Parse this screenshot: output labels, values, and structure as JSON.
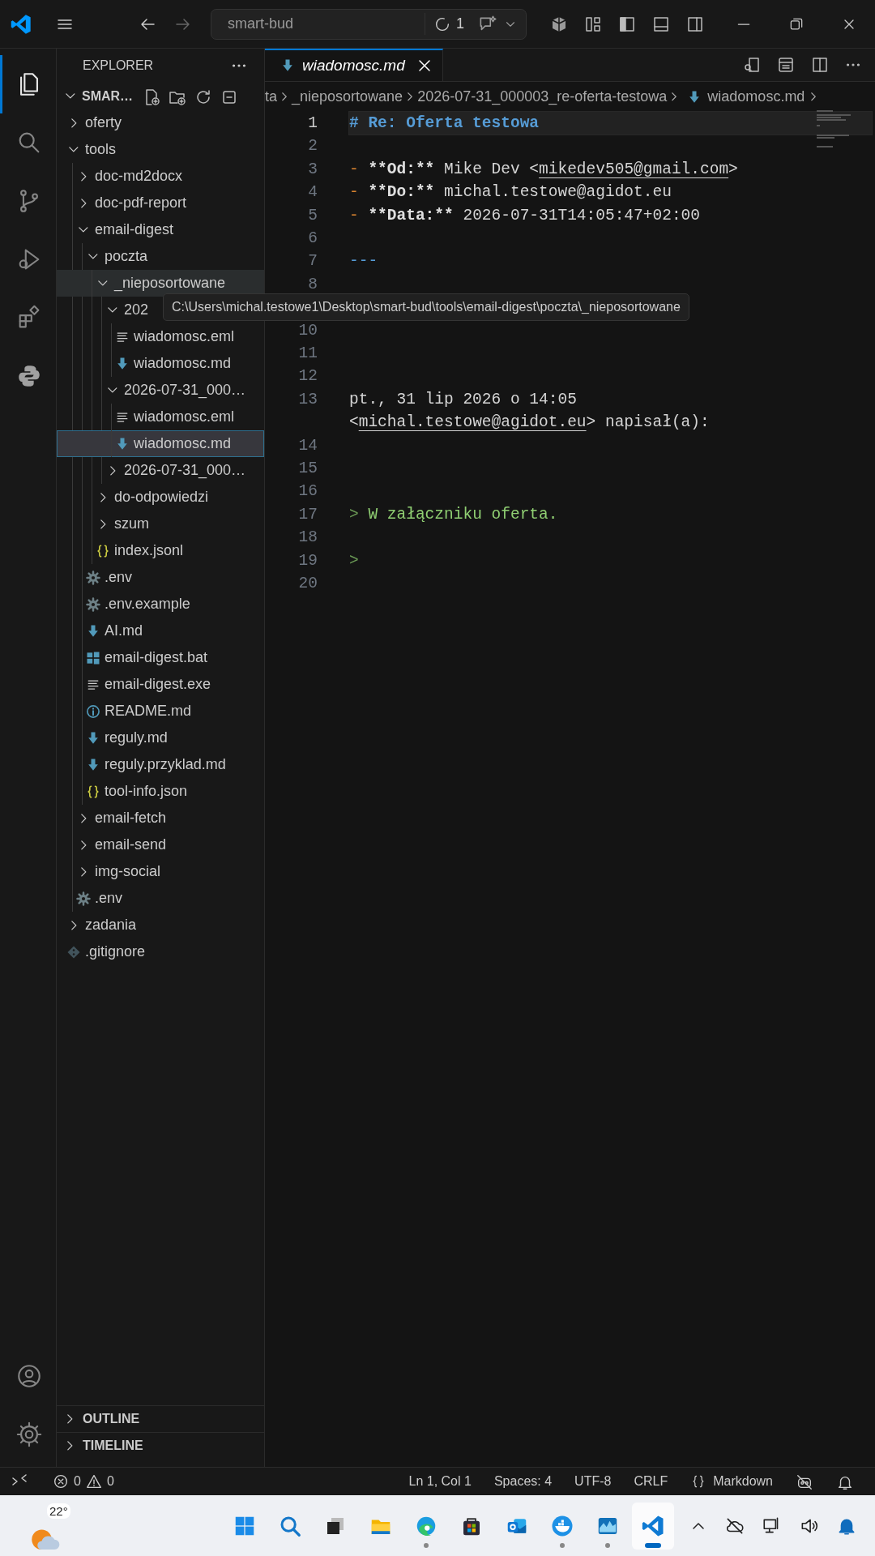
{
  "title_bar": {
    "search": "smart-bud",
    "agent_count": "1"
  },
  "activity_bar": [
    {
      "kind": "explorer",
      "selected": true
    },
    {
      "kind": "search",
      "selected": false
    },
    {
      "kind": "source-control",
      "selected": false
    },
    {
      "kind": "run-debug",
      "selected": false
    },
    {
      "kind": "extensions",
      "selected": false
    },
    {
      "kind": "python",
      "selected": false
    }
  ],
  "explorer": {
    "title": "EXPLORER",
    "root": "SMAR…",
    "expanded": true,
    "tree": [
      {
        "kind": "folder",
        "label": "oferty",
        "expanded": false,
        "selected": false,
        "hovered": false
      },
      {
        "kind": "folder",
        "label": "tools",
        "expanded": true,
        "selected": false,
        "hovered": false,
        "children": [
          {
            "kind": "folder",
            "label": "doc-md2docx",
            "expanded": false,
            "selected": false,
            "hovered": false
          },
          {
            "kind": "folder",
            "label": "doc-pdf-report",
            "expanded": false,
            "selected": false,
            "hovered": false
          },
          {
            "kind": "folder",
            "label": "email-digest",
            "expanded": true,
            "selected": false,
            "hovered": false,
            "children": [
              {
                "kind": "folder",
                "label": "poczta",
                "expanded": true,
                "selected": false,
                "hovered": false,
                "children": [
                  {
                    "kind": "folder",
                    "label": "_nieposortowane",
                    "expanded": true,
                    "selected": false,
                    "hovered": true,
                    "children": [
                      {
                        "kind": "folder",
                        "label": "202",
                        "expanded": true,
                        "selected": false,
                        "hovered": false,
                        "children": [
                          {
                            "kind": "text-file",
                            "label": "wiadomosc.eml",
                            "selected": false,
                            "hovered": false
                          },
                          {
                            "kind": "md-file",
                            "label": "wiadomosc.md",
                            "selected": false,
                            "hovered": false
                          }
                        ]
                      },
                      {
                        "kind": "folder",
                        "label": "2026-07-31_000…",
                        "expanded": true,
                        "selected": false,
                        "hovered": false,
                        "children": [
                          {
                            "kind": "text-file",
                            "label": "wiadomosc.eml",
                            "selected": false,
                            "hovered": false
                          },
                          {
                            "kind": "md-file",
                            "label": "wiadomosc.md",
                            "selected": true,
                            "hovered": false
                          }
                        ]
                      },
                      {
                        "kind": "folder",
                        "label": "2026-07-31_000…",
                        "expanded": false,
                        "selected": false,
                        "hovered": false
                      }
                    ]
                  },
                  {
                    "kind": "folder",
                    "label": "do-odpowiedzi",
                    "expanded": false,
                    "selected": false,
                    "hovered": false
                  },
                  {
                    "kind": "folder",
                    "label": "szum",
                    "expanded": false,
                    "selected": false,
                    "hovered": false
                  },
                  {
                    "kind": "json-file",
                    "label": "index.jsonl",
                    "selected": false,
                    "hovered": false
                  }
                ]
              },
              {
                "kind": "settings-file",
                "label": ".env",
                "selected": false,
                "hovered": false
              },
              {
                "kind": "settings-file",
                "label": ".env.example",
                "selected": false,
                "hovered": false
              },
              {
                "kind": "md-file",
                "label": "AI.md",
                "selected": false,
                "hovered": false
              },
              {
                "kind": "windows-file",
                "label": "email-digest.bat",
                "selected": false,
                "hovered": false
              },
              {
                "kind": "text-file",
                "label": "email-digest.exe",
                "selected": false,
                "hovered": false
              },
              {
                "kind": "info-file",
                "label": "README.md",
                "selected": false,
                "hovered": false
              },
              {
                "kind": "md-file",
                "label": "reguly.md",
                "selected": false,
                "hovered": false
              },
              {
                "kind": "md-file",
                "label": "reguly.przyklad.md",
                "selected": false,
                "hovered": false
              },
              {
                "kind": "json-file",
                "label": "tool-info.json",
                "selected": false,
                "hovered": false
              }
            ]
          },
          {
            "kind": "folder",
            "label": "email-fetch",
            "expanded": false,
            "selected": false,
            "hovered": false
          },
          {
            "kind": "folder",
            "label": "email-send",
            "expanded": false,
            "selected": false,
            "hovered": false
          },
          {
            "kind": "folder",
            "label": "img-social",
            "expanded": false,
            "selected": false,
            "hovered": false
          },
          {
            "kind": "settings-file",
            "label": ".env",
            "selected": false,
            "hovered": false
          }
        ]
      },
      {
        "kind": "folder",
        "label": "zadania",
        "expanded": false,
        "selected": false,
        "hovered": false
      },
      {
        "kind": "git-file",
        "label": ".gitignore",
        "selected": false,
        "hovered": false
      }
    ],
    "sections": [
      {
        "label": "OUTLINE",
        "expanded": false
      },
      {
        "label": "TIMELINE",
        "expanded": false
      }
    ]
  },
  "tooltip": "C:\\Users\\michal.testowe1\\Desktop\\smart-bud\\tools\\email-digest\\poczta\\_nieposortowane",
  "tab": {
    "label": "wiadomosc.md",
    "preview": true
  },
  "breadcrumb": [
    {
      "kind": "folder",
      "label": "ta"
    },
    {
      "kind": "folder",
      "label": "_nieposortowane"
    },
    {
      "kind": "folder",
      "label": "2026-07-31_000003_re-oferta-testowa"
    },
    {
      "kind": "md-file",
      "label": "wiadomosc.md"
    }
  ],
  "editor": {
    "lines": [
      {
        "number": "1",
        "current": true,
        "segments": [
          {
            "kind": "heading",
            "text": "# Re: Oferta testowa"
          }
        ]
      },
      {
        "number": "2",
        "current": false
      },
      {
        "number": "3",
        "current": false,
        "segments": [
          {
            "kind": "bullet",
            "text": "- "
          },
          {
            "kind": "bold",
            "text": "**Od:**"
          },
          {
            "kind": "plain",
            "text": " Mike Dev <"
          },
          {
            "kind": "link",
            "text": "mikedev505@gmail.com"
          },
          {
            "kind": "plain",
            "text": ">"
          }
        ]
      },
      {
        "number": "4",
        "current": false,
        "segments": [
          {
            "kind": "bullet",
            "text": "- "
          },
          {
            "kind": "bold",
            "text": "**Do:**"
          },
          {
            "kind": "plain",
            "text": " michal.testowe@agidot.eu"
          }
        ]
      },
      {
        "number": "5",
        "current": false,
        "segments": [
          {
            "kind": "bullet",
            "text": "- "
          },
          {
            "kind": "bold",
            "text": "**Data:**"
          },
          {
            "kind": "plain",
            "text": " 2026-07-31T14:05:47+02:00"
          }
        ]
      },
      {
        "number": "6",
        "current": false
      },
      {
        "number": "7",
        "current": false,
        "segments": [
          {
            "kind": "rule",
            "text": "---"
          }
        ]
      },
      {
        "number": "8",
        "current": false
      },
      {
        "kind": "covered"
      },
      {
        "number": "10",
        "current": false
      },
      {
        "number": "11",
        "current": false
      },
      {
        "number": "12",
        "current": false
      },
      {
        "number": "13",
        "current": false,
        "segments": [
          {
            "kind": "plain",
            "text": "pt., 31 lip 2026 o 14:05 <"
          },
          {
            "kind": "link",
            "text": "michal.testowe@agidot.eu"
          },
          {
            "kind": "plain",
            "text": "> napisał(a):"
          }
        ]
      },
      {
        "number": "14",
        "current": false
      },
      {
        "number": "15",
        "current": false
      },
      {
        "number": "16",
        "current": false
      },
      {
        "number": "17",
        "current": false,
        "segments": [
          {
            "kind": "quote-mark",
            "text": "> "
          },
          {
            "kind": "quote",
            "text": "W załączniku oferta."
          }
        ]
      },
      {
        "number": "18",
        "current": false
      },
      {
        "number": "19",
        "current": false,
        "segments": [
          {
            "kind": "quote-mark",
            "text": ">"
          }
        ]
      },
      {
        "number": "20",
        "current": false
      }
    ]
  },
  "status_bar": {
    "errors": "0",
    "warnings": "0",
    "items": [
      "Ln 1, Col 1",
      "Spaces: 4",
      "UTF-8",
      "CRLF"
    ],
    "language": "Markdown"
  },
  "taskbar": {
    "weather": "22°",
    "apps": [
      {
        "kind": "start",
        "running": false,
        "active": false
      },
      {
        "kind": "search",
        "running": false,
        "active": false
      },
      {
        "kind": "task-view",
        "running": false,
        "active": false
      },
      {
        "kind": "file-explorer",
        "running": false,
        "active": false
      },
      {
        "kind": "edge",
        "running": true,
        "active": false
      },
      {
        "kind": "store",
        "running": false,
        "active": false
      },
      {
        "kind": "outlook",
        "running": false,
        "active": false
      },
      {
        "kind": "docker",
        "running": true,
        "active": false
      },
      {
        "kind": "monitor",
        "running": true,
        "active": false
      },
      {
        "kind": "vscode",
        "running": true,
        "active": true
      }
    ]
  }
}
